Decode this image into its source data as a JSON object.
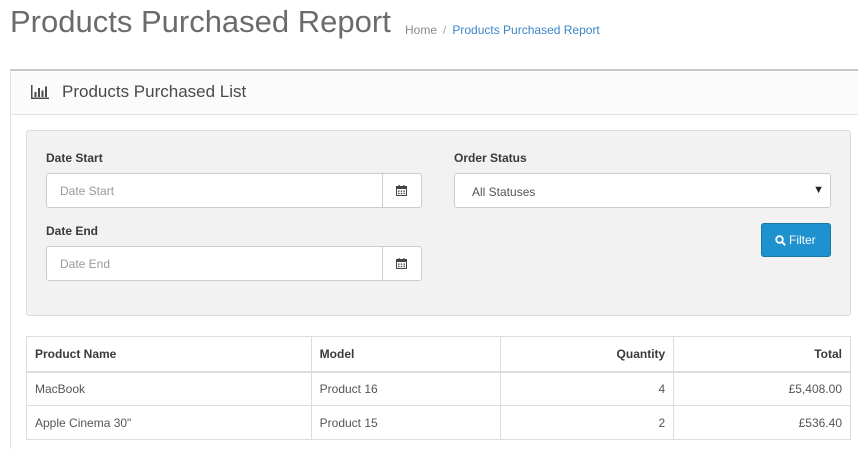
{
  "header": {
    "title": "Products Purchased Report",
    "breadcrumb": {
      "home": "Home",
      "separator": "/",
      "current": "Products Purchased Report"
    }
  },
  "panel": {
    "title": "Products Purchased List",
    "icon": "bar-chart-icon"
  },
  "filters": {
    "date_start": {
      "label": "Date Start",
      "placeholder": "Date Start",
      "value": ""
    },
    "date_end": {
      "label": "Date End",
      "placeholder": "Date End",
      "value": ""
    },
    "order_status": {
      "label": "Order Status",
      "selected": "All Statuses"
    },
    "filter_button": {
      "label": "Filter",
      "icon": "search-icon"
    }
  },
  "table": {
    "columns": [
      "Product Name",
      "Model",
      "Quantity",
      "Total"
    ],
    "rows": [
      {
        "name": "MacBook",
        "model": "Product 16",
        "quantity": "4",
        "total": "£5,408.00"
      },
      {
        "name": "Apple Cinema 30\"",
        "model": "Product 15",
        "quantity": "2",
        "total": "£536.40"
      }
    ]
  },
  "colors": {
    "accent": "#1e91cf",
    "link": "#3a86c8"
  }
}
